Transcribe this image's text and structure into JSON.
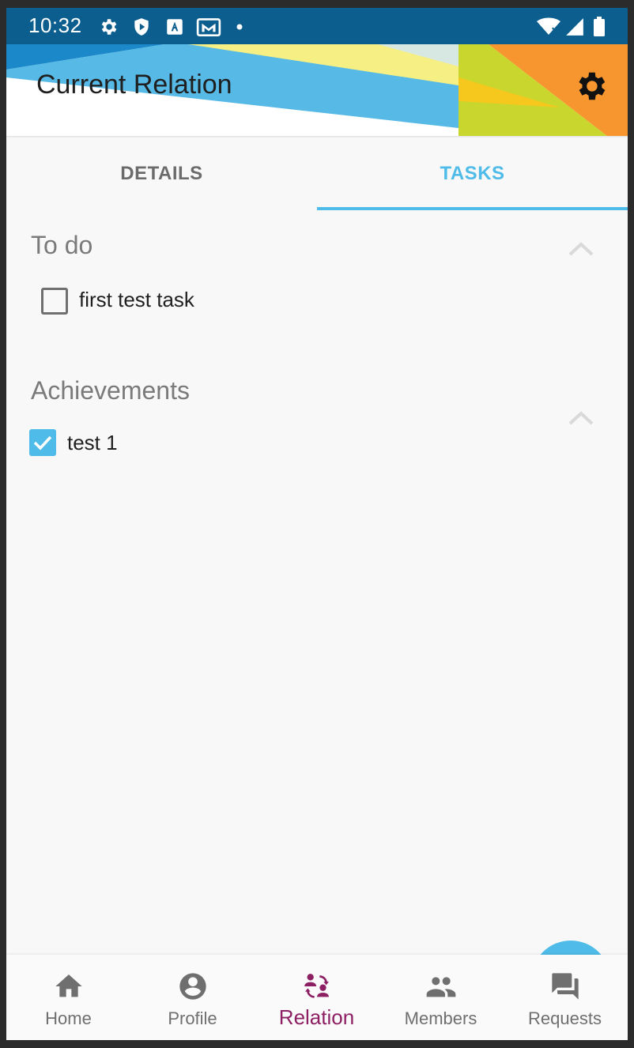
{
  "status_bar": {
    "time": "10:32"
  },
  "header": {
    "title": "Current Relation"
  },
  "tabs": [
    {
      "label": "DETAILS",
      "active": false
    },
    {
      "label": "TASKS",
      "active": true
    }
  ],
  "sections": {
    "todo": {
      "title": "To do",
      "tasks": [
        {
          "label": "first test task",
          "checked": false
        }
      ]
    },
    "achievements": {
      "title": "Achievements",
      "tasks": [
        {
          "label": "test 1",
          "checked": true
        }
      ]
    }
  },
  "bottom_nav": [
    {
      "label": "Home",
      "icon": "home-icon",
      "active": false
    },
    {
      "label": "Profile",
      "icon": "account-circle-icon",
      "active": false
    },
    {
      "label": "Relation",
      "icon": "relation-icon",
      "active": true
    },
    {
      "label": "Members",
      "icon": "group-icon",
      "active": false
    },
    {
      "label": "Requests",
      "icon": "forum-icon",
      "active": false
    }
  ],
  "colors": {
    "status_bar": "#0b5e8e",
    "accent_blue": "#4fbbe8",
    "active_nav": "#8d1f63",
    "background": "#f8f8f8"
  }
}
